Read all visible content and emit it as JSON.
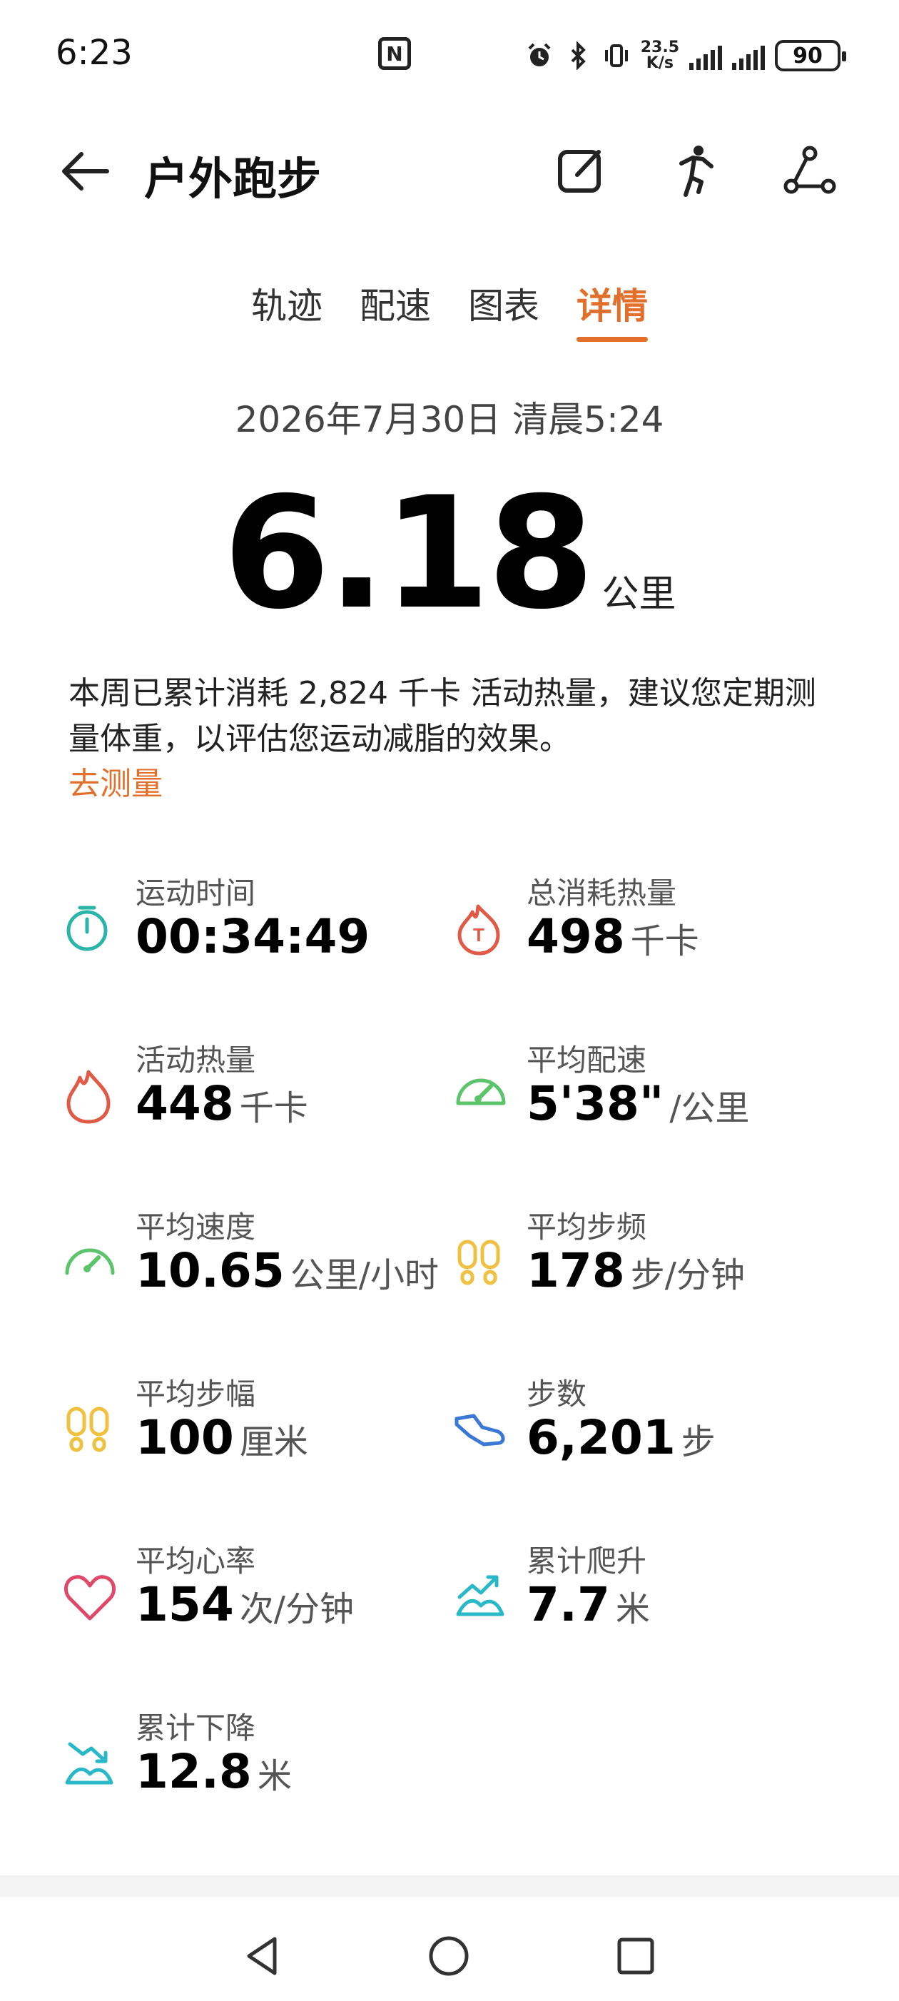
{
  "status_bar": {
    "time": "6:23",
    "net_speed_value": "23.5",
    "net_speed_unit": "K/s",
    "battery": "90",
    "icons": [
      "nfc-icon",
      "alarm-icon",
      "bluetooth-icon",
      "vibrate-icon",
      "signal-icon",
      "signal-icon",
      "battery-icon"
    ]
  },
  "header": {
    "title": "户外跑步",
    "icons": [
      "back-arrow-icon",
      "edit-icon",
      "runner-icon",
      "share-icon"
    ]
  },
  "tabs": [
    {
      "label": "轨迹",
      "active": false
    },
    {
      "label": "配速",
      "active": false
    },
    {
      "label": "图表",
      "active": false
    },
    {
      "label": "详情",
      "active": true
    }
  ],
  "summary": {
    "date": "2026年7月30日 清晨5:24",
    "distance": "6.18",
    "distance_unit": "公里"
  },
  "tip": {
    "text": "本周已累计消耗 2,824 千卡 活动热量，建议您定期测量体重，以评估您运动减脂的效果。",
    "link": "去测量"
  },
  "stats": [
    {
      "label": "运动时间",
      "value": "00:34:49",
      "unit": "",
      "icon": "stopwatch-icon"
    },
    {
      "label": "总消耗热量",
      "value": "498",
      "unit": "千卡",
      "icon": "total-calorie-icon"
    },
    {
      "label": "活动热量",
      "value": "448",
      "unit": "千卡",
      "icon": "flame-icon"
    },
    {
      "label": "平均配速",
      "value": "5'38\"",
      "unit": "/公里",
      "icon": "pace-gauge-icon"
    },
    {
      "label": "平均速度",
      "value": "10.65",
      "unit": "公里/小时",
      "icon": "speedometer-icon"
    },
    {
      "label": "平均步频",
      "value": "178",
      "unit": "步/分钟",
      "icon": "footprints-icon"
    },
    {
      "label": "平均步幅",
      "value": "100",
      "unit": "厘米",
      "icon": "footprints-icon"
    },
    {
      "label": "步数",
      "value": "6,201",
      "unit": "步",
      "icon": "shoe-icon"
    },
    {
      "label": "平均心率",
      "value": "154",
      "unit": "次/分钟",
      "icon": "heart-icon"
    },
    {
      "label": "累计爬升",
      "value": "7.7",
      "unit": "米",
      "icon": "ascent-icon"
    },
    {
      "label": "累计下降",
      "value": "12.8",
      "unit": "米",
      "icon": "descent-icon"
    }
  ],
  "colors": {
    "accent": "#e2702c",
    "teal": "#2bb5a8",
    "red": "#e05a45",
    "green": "#5cc46a",
    "yellow": "#f0c040",
    "blue": "#3a78d8",
    "pink": "#e0486a",
    "cyan": "#29b8c8"
  },
  "nav_bar": {
    "icons": [
      "back-triangle-icon",
      "home-circle-icon",
      "recents-square-icon"
    ]
  }
}
